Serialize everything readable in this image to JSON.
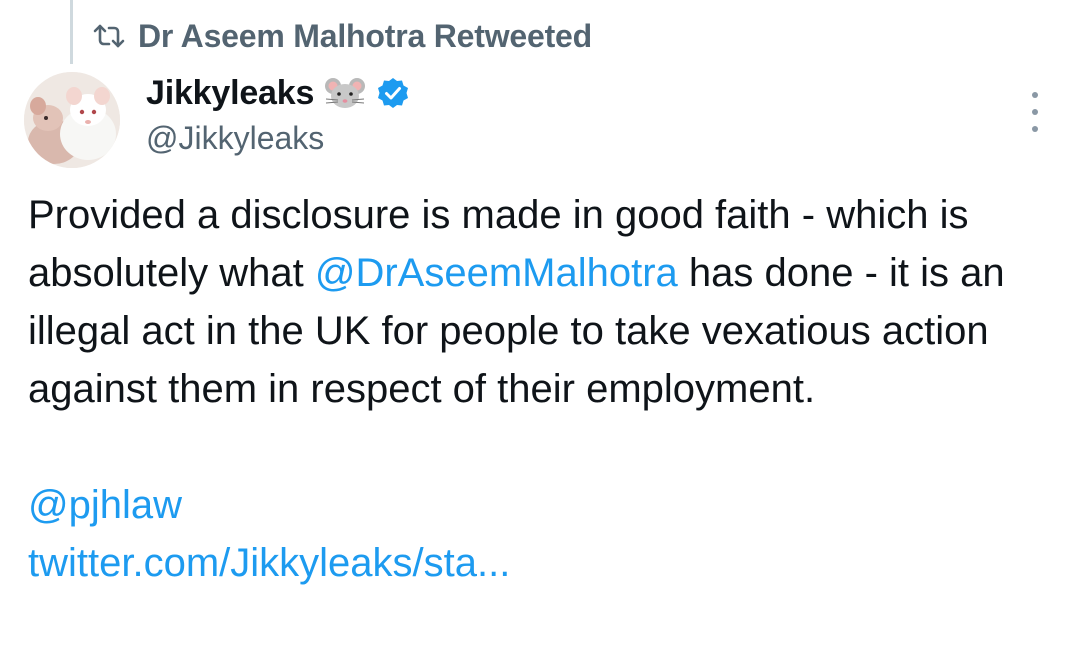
{
  "retweet_header": {
    "icon": "retweet-icon",
    "text": "Dr Aseem Malhotra Retweeted"
  },
  "author": {
    "display_name": "Jikkyleaks",
    "emoji": "🐭",
    "verified": true,
    "verified_color": "#1d9bf0",
    "handle": "@Jikkyleaks",
    "avatar_icon": "mice-avatar"
  },
  "tweet": {
    "text_part1": "Provided a disclosure is made in good faith - which is absolutely what ",
    "mention1": "@DrAseemMalhotra",
    "text_part2": " has done - it is an illegal act in the UK for people to take vexatious action against them in respect of their employment.",
    "mention2": "@pjhlaw",
    "link": "twitter.com/Jikkyleaks/sta..."
  },
  "colors": {
    "link": "#1d9bf0",
    "secondary_text": "#536471",
    "primary_text": "#0f1419"
  }
}
